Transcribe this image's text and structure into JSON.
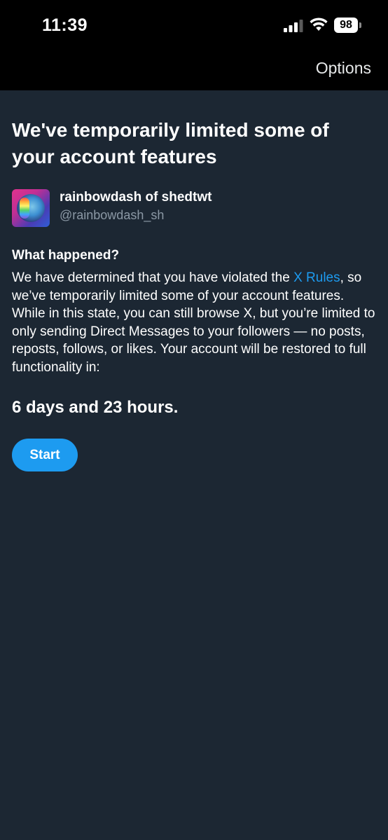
{
  "status_bar": {
    "time": "11:39",
    "battery_level": "98",
    "signal_icon": "cellular-signal-icon",
    "wifi_icon": "wifi-icon"
  },
  "nav": {
    "options_label": "Options"
  },
  "notice": {
    "title": "We've temporarily limited some of your account features",
    "account": {
      "display_name": "rainbowdash of shedtwt",
      "handle": "@rainbowdash_sh"
    },
    "what_happened_heading": "What happened?",
    "body_before_link": "We have determined that you have violated the ",
    "body_link": "X Rules",
    "body_after_link": ", so we’ve temporarily limited some of your account features. While in this state, you can still browse X, but you’re limited to only sending Direct Messages to your followers — no posts, reposts, follows, or likes. Your account will be restored to full functionality in:",
    "countdown": "6 days and 23 hours.",
    "start_button_label": "Start"
  },
  "colors": {
    "background": "#1c2733",
    "bars": "#000000",
    "accent": "#1d9bf0",
    "secondary_text": "#8b98a5"
  }
}
